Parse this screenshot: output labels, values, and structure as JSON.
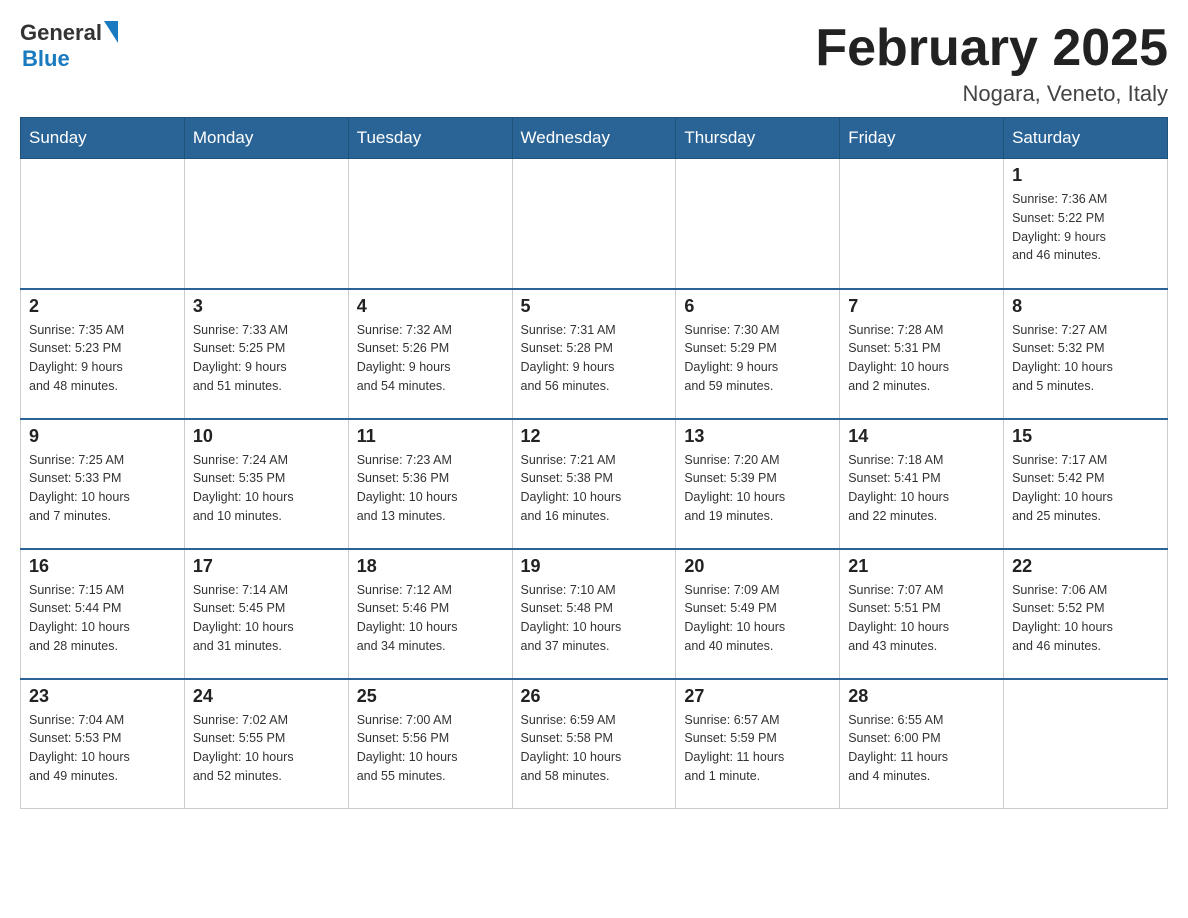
{
  "header": {
    "logo_line1": "General",
    "logo_line2": "Blue",
    "month_title": "February 2025",
    "location": "Nogara, Veneto, Italy"
  },
  "days_of_week": [
    "Sunday",
    "Monday",
    "Tuesday",
    "Wednesday",
    "Thursday",
    "Friday",
    "Saturday"
  ],
  "weeks": [
    [
      {
        "day": "",
        "info": ""
      },
      {
        "day": "",
        "info": ""
      },
      {
        "day": "",
        "info": ""
      },
      {
        "day": "",
        "info": ""
      },
      {
        "day": "",
        "info": ""
      },
      {
        "day": "",
        "info": ""
      },
      {
        "day": "1",
        "info": "Sunrise: 7:36 AM\nSunset: 5:22 PM\nDaylight: 9 hours\nand 46 minutes."
      }
    ],
    [
      {
        "day": "2",
        "info": "Sunrise: 7:35 AM\nSunset: 5:23 PM\nDaylight: 9 hours\nand 48 minutes."
      },
      {
        "day": "3",
        "info": "Sunrise: 7:33 AM\nSunset: 5:25 PM\nDaylight: 9 hours\nand 51 minutes."
      },
      {
        "day": "4",
        "info": "Sunrise: 7:32 AM\nSunset: 5:26 PM\nDaylight: 9 hours\nand 54 minutes."
      },
      {
        "day": "5",
        "info": "Sunrise: 7:31 AM\nSunset: 5:28 PM\nDaylight: 9 hours\nand 56 minutes."
      },
      {
        "day": "6",
        "info": "Sunrise: 7:30 AM\nSunset: 5:29 PM\nDaylight: 9 hours\nand 59 minutes."
      },
      {
        "day": "7",
        "info": "Sunrise: 7:28 AM\nSunset: 5:31 PM\nDaylight: 10 hours\nand 2 minutes."
      },
      {
        "day": "8",
        "info": "Sunrise: 7:27 AM\nSunset: 5:32 PM\nDaylight: 10 hours\nand 5 minutes."
      }
    ],
    [
      {
        "day": "9",
        "info": "Sunrise: 7:25 AM\nSunset: 5:33 PM\nDaylight: 10 hours\nand 7 minutes."
      },
      {
        "day": "10",
        "info": "Sunrise: 7:24 AM\nSunset: 5:35 PM\nDaylight: 10 hours\nand 10 minutes."
      },
      {
        "day": "11",
        "info": "Sunrise: 7:23 AM\nSunset: 5:36 PM\nDaylight: 10 hours\nand 13 minutes."
      },
      {
        "day": "12",
        "info": "Sunrise: 7:21 AM\nSunset: 5:38 PM\nDaylight: 10 hours\nand 16 minutes."
      },
      {
        "day": "13",
        "info": "Sunrise: 7:20 AM\nSunset: 5:39 PM\nDaylight: 10 hours\nand 19 minutes."
      },
      {
        "day": "14",
        "info": "Sunrise: 7:18 AM\nSunset: 5:41 PM\nDaylight: 10 hours\nand 22 minutes."
      },
      {
        "day": "15",
        "info": "Sunrise: 7:17 AM\nSunset: 5:42 PM\nDaylight: 10 hours\nand 25 minutes."
      }
    ],
    [
      {
        "day": "16",
        "info": "Sunrise: 7:15 AM\nSunset: 5:44 PM\nDaylight: 10 hours\nand 28 minutes."
      },
      {
        "day": "17",
        "info": "Sunrise: 7:14 AM\nSunset: 5:45 PM\nDaylight: 10 hours\nand 31 minutes."
      },
      {
        "day": "18",
        "info": "Sunrise: 7:12 AM\nSunset: 5:46 PM\nDaylight: 10 hours\nand 34 minutes."
      },
      {
        "day": "19",
        "info": "Sunrise: 7:10 AM\nSunset: 5:48 PM\nDaylight: 10 hours\nand 37 minutes."
      },
      {
        "day": "20",
        "info": "Sunrise: 7:09 AM\nSunset: 5:49 PM\nDaylight: 10 hours\nand 40 minutes."
      },
      {
        "day": "21",
        "info": "Sunrise: 7:07 AM\nSunset: 5:51 PM\nDaylight: 10 hours\nand 43 minutes."
      },
      {
        "day": "22",
        "info": "Sunrise: 7:06 AM\nSunset: 5:52 PM\nDaylight: 10 hours\nand 46 minutes."
      }
    ],
    [
      {
        "day": "23",
        "info": "Sunrise: 7:04 AM\nSunset: 5:53 PM\nDaylight: 10 hours\nand 49 minutes."
      },
      {
        "day": "24",
        "info": "Sunrise: 7:02 AM\nSunset: 5:55 PM\nDaylight: 10 hours\nand 52 minutes."
      },
      {
        "day": "25",
        "info": "Sunrise: 7:00 AM\nSunset: 5:56 PM\nDaylight: 10 hours\nand 55 minutes."
      },
      {
        "day": "26",
        "info": "Sunrise: 6:59 AM\nSunset: 5:58 PM\nDaylight: 10 hours\nand 58 minutes."
      },
      {
        "day": "27",
        "info": "Sunrise: 6:57 AM\nSunset: 5:59 PM\nDaylight: 11 hours\nand 1 minute."
      },
      {
        "day": "28",
        "info": "Sunrise: 6:55 AM\nSunset: 6:00 PM\nDaylight: 11 hours\nand 4 minutes."
      },
      {
        "day": "",
        "info": ""
      }
    ]
  ]
}
